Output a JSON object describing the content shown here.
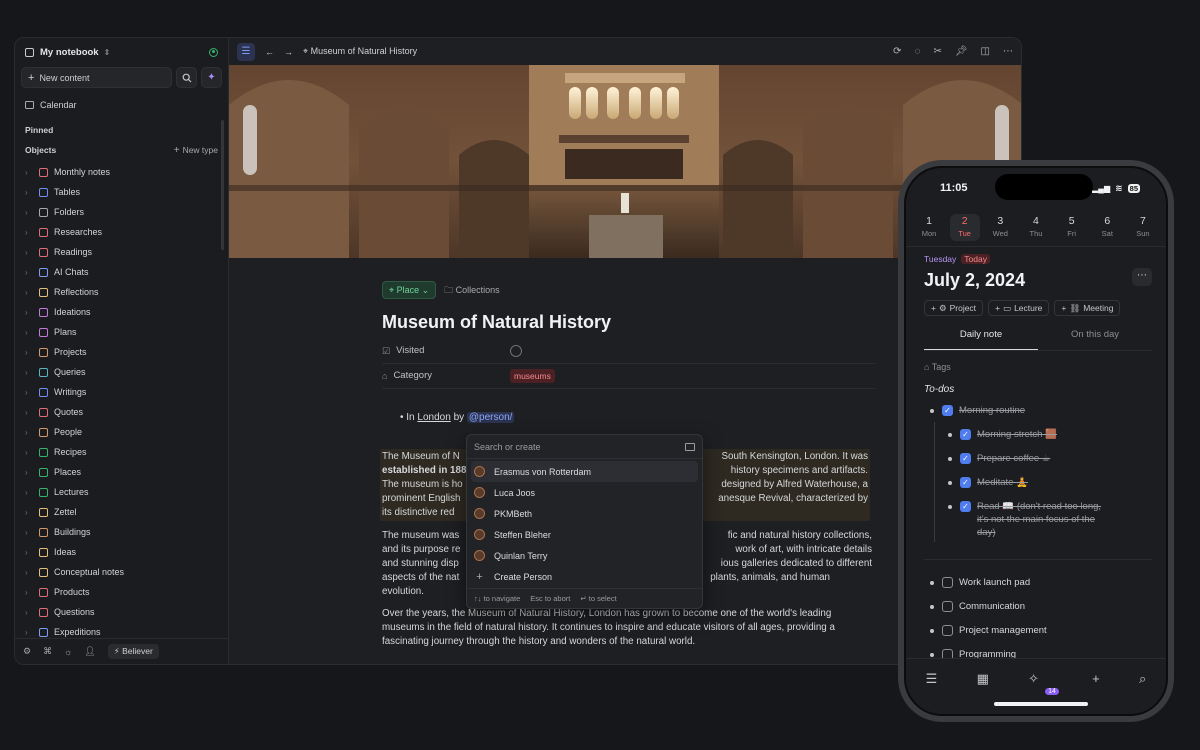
{
  "sidebar": {
    "notebook": "My notebook",
    "new_content": "New content",
    "calendar": "Calendar",
    "pinned": "Pinned",
    "objects": "Objects",
    "new_type": "New type",
    "items": [
      {
        "label": "Monthly notes",
        "color": "#e06c75"
      },
      {
        "label": "Tables",
        "color": "#6f8ff2"
      },
      {
        "label": "Folders",
        "color": "#a7a9ad"
      },
      {
        "label": "Researches",
        "color": "#e06c75"
      },
      {
        "label": "Readings",
        "color": "#e06c75"
      },
      {
        "label": "AI Chats",
        "color": "#7c9cf5"
      },
      {
        "label": "Reflections",
        "color": "#e5c07b"
      },
      {
        "label": "Ideations",
        "color": "#c678dd"
      },
      {
        "label": "Plans",
        "color": "#c678dd"
      },
      {
        "label": "Projects",
        "color": "#d19a66"
      },
      {
        "label": "Queries",
        "color": "#56b6c2"
      },
      {
        "label": "Writings",
        "color": "#6f8ff2"
      },
      {
        "label": "Quotes",
        "color": "#e06c75"
      },
      {
        "label": "People",
        "color": "#d19a66"
      },
      {
        "label": "Recipes",
        "color": "#35b36a"
      },
      {
        "label": "Places",
        "color": "#35b36a"
      },
      {
        "label": "Lectures",
        "color": "#35b36a"
      },
      {
        "label": "Zettel",
        "color": "#e5c07b"
      },
      {
        "label": "Buildings",
        "color": "#d19a66"
      },
      {
        "label": "Ideas",
        "color": "#e5c07b"
      },
      {
        "label": "Conceptual notes",
        "color": "#e5c07b"
      },
      {
        "label": "Products",
        "color": "#e06c75"
      },
      {
        "label": "Questions",
        "color": "#e06c75"
      },
      {
        "label": "Expeditions",
        "color": "#7c9cf5"
      }
    ],
    "footer_user": "Believer"
  },
  "topbar": {
    "breadcrumb": "Museum of Natural History"
  },
  "doc": {
    "place_chip": "Place",
    "collections": "Collections",
    "title": "Museum of Natural History",
    "prop_visited": "Visited",
    "prop_category": "Category",
    "category_value": "museums",
    "bullet_prefix": "In",
    "bullet_link": "London",
    "bullet_by": "by",
    "bullet_mention": "@person/",
    "para1_l1a": "The Museum of N",
    "para1_l1b": "South Kensington, London. It was",
    "para1_l2a": "established in 188",
    "para1_l2b": "history specimens and artifacts.",
    "para1_l3a": "The museum is ho",
    "para1_l3b": "designed by Alfred Waterhouse, a",
    "para1_l4a": "prominent English",
    "para1_l4b": "anesque Revival, characterized by",
    "para1_l5a": "its distinctive red",
    "para2_l1a": "The museum was",
    "para2_l1b": "fic and natural history collections,",
    "para2_l2a": "and its purpose re",
    "para2_l2b": "work of art, with intricate details",
    "para2_l3a": "and stunning disp",
    "para2_l3b": "ious galleries dedicated to different",
    "para2_l4a": "aspects of the nat",
    "para2_l4b": "plants, animals, and human",
    "para2_l5a": "evolution.",
    "para3": "Over the years, the Museum of Natural History, London has grown to become one of the world's leading museums in the field of natural history. It continues to inspire and educate visitors of all ages, providing a fascinating journey through the history and wonders of the natural world."
  },
  "popup": {
    "placeholder": "Search or create",
    "people": [
      "Erasmus von Rotterdam",
      "Luca Joos",
      "PKMBeth",
      "Steffen Bleher",
      "Quinlan Terry"
    ],
    "create": "Create Person",
    "hint_nav": "to navigate",
    "hint_abort": "to abort",
    "hint_select": "to select",
    "key_nav": "↑↓",
    "key_abort": "Esc",
    "key_select": "↵"
  },
  "phone": {
    "time": "11:05",
    "battery": "85",
    "week": [
      {
        "n": "1",
        "d": "Mon"
      },
      {
        "n": "2",
        "d": "Tue"
      },
      {
        "n": "3",
        "d": "Wed"
      },
      {
        "n": "4",
        "d": "Thu"
      },
      {
        "n": "5",
        "d": "Fri"
      },
      {
        "n": "6",
        "d": "Sat"
      },
      {
        "n": "7",
        "d": "Sun"
      }
    ],
    "weekday": "Tuesday",
    "today": "Today",
    "date": "July 2, 2024",
    "pills": [
      "Project",
      "Lecture",
      "Meeting"
    ],
    "tab_daily": "Daily note",
    "tab_this_day": "On this day",
    "tags": "Tags",
    "todos_head": "To-dos",
    "todo_main": "Morning routine",
    "todo_subs": [
      "Morning stretch 🟫",
      "Prepare coffee ☕",
      "Meditate 🧘"
    ],
    "todo_read_1": "Read 📖 (don't read too long,",
    "todo_read_2": "it's not the main focus of the",
    "todo_read_3": "day)",
    "open_todos": [
      "Work launch pad",
      "Communication",
      "Project management",
      "Programming"
    ],
    "badge": "14"
  }
}
